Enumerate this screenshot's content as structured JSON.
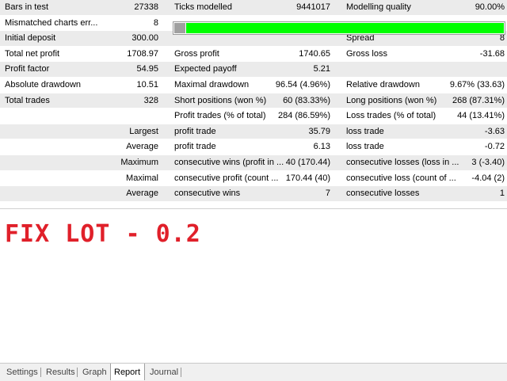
{
  "report": {
    "rows": [
      {
        "c0": "Bars in test",
        "v0": "27338",
        "c1": "Ticks modelled",
        "v1": "9441017",
        "c2": "Modelling quality",
        "v2": "90.00%"
      },
      {
        "c0": "Mismatched charts err...",
        "v0": "8",
        "quality_bar": {
          "quality_fraction": 0.9
        }
      },
      {
        "c0": "Initial deposit",
        "v0": "300.00",
        "c1": "",
        "v1": "",
        "c2": "Spread",
        "v2": "8"
      },
      {
        "c0": "Total net profit",
        "v0": "1708.97",
        "c1": "Gross profit",
        "v1": "1740.65",
        "c2": "Gross loss",
        "v2": "-31.68"
      },
      {
        "c0": "Profit factor",
        "v0": "54.95",
        "c1": "Expected payoff",
        "v1": "5.21",
        "c2": "",
        "v2": ""
      },
      {
        "c0": "Absolute drawdown",
        "v0": "10.51",
        "c1": "Maximal drawdown",
        "v1": "96.54 (4.96%)",
        "c2": "Relative drawdown",
        "v2": "9.67% (33.63)"
      },
      {
        "c0": "Total trades",
        "v0": "328",
        "c1": "Short positions (won %)",
        "v1": "60 (83.33%)",
        "c2": "Long positions (won %)",
        "v2": "268 (87.31%)"
      },
      {
        "c0": "",
        "v0": "",
        "c1": "Profit trades (% of total)",
        "v1": "284 (86.59%)",
        "c2": "Loss trades (% of total)",
        "v2": "44 (13.41%)"
      },
      {
        "c0": "",
        "v0": "Largest",
        "c1": "profit trade",
        "v1": "35.79",
        "c2": "loss trade",
        "v2": "-3.63"
      },
      {
        "c0": "",
        "v0": "Average",
        "c1": "profit trade",
        "v1": "6.13",
        "c2": "loss trade",
        "v2": "-0.72"
      },
      {
        "c0": "",
        "v0": "Maximum",
        "c1": "consecutive wins (profit in ...",
        "v1": "40 (170.44)",
        "c2": "consecutive losses (loss in ...",
        "v2": "3 (-3.40)"
      },
      {
        "c0": "",
        "v0": "Maximal",
        "c1": "consecutive profit (count ...",
        "v1": "170.44 (40)",
        "c2": "consecutive loss (count of ...",
        "v2": "-4.04 (2)"
      },
      {
        "c0": "",
        "v0": "Average",
        "c1": "consecutive wins",
        "v1": "7",
        "c2": "consecutive losses",
        "v2": "1"
      }
    ]
  },
  "annotation": {
    "text": "FIX LOT - 0.2",
    "color": "#e0202a"
  },
  "tabs": {
    "items": [
      {
        "label": "Settings"
      },
      {
        "label": "Results"
      },
      {
        "label": "Graph"
      },
      {
        "label": "Report"
      },
      {
        "label": "Journal"
      }
    ],
    "active": "Report"
  },
  "colors": {
    "row_alt": "#ebebeb",
    "quality_green": "#00ff00",
    "quality_gray": "#a0a0a0"
  }
}
